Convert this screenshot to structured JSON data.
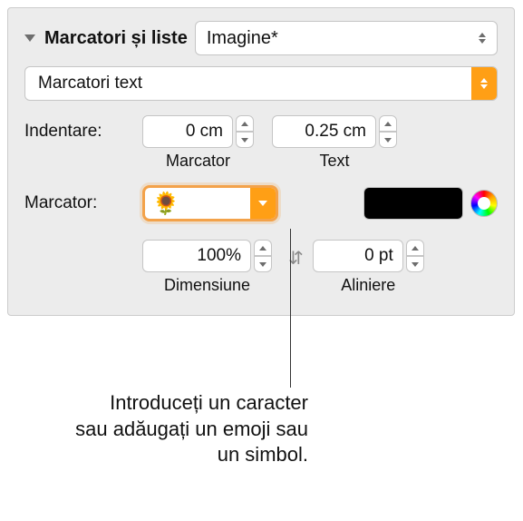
{
  "section": {
    "title": "Marcatori și liste",
    "style_selected": "Imagine*"
  },
  "type_select": {
    "selected": "Marcatori text"
  },
  "indentare": {
    "label": "Indentare:",
    "marcator": {
      "value": "0 cm",
      "sublabel": "Marcator"
    },
    "text": {
      "value": "0.25 cm",
      "sublabel": "Text"
    }
  },
  "marcator": {
    "label": "Marcator:",
    "character": "🌻",
    "color": "#000000"
  },
  "size": {
    "value": "100%",
    "sublabel": "Dimensiune"
  },
  "align": {
    "value": "0 pt",
    "sublabel": "Aliniere"
  },
  "caption": "Introduceți un caracter sau adăugați un emoji sau un simbol."
}
